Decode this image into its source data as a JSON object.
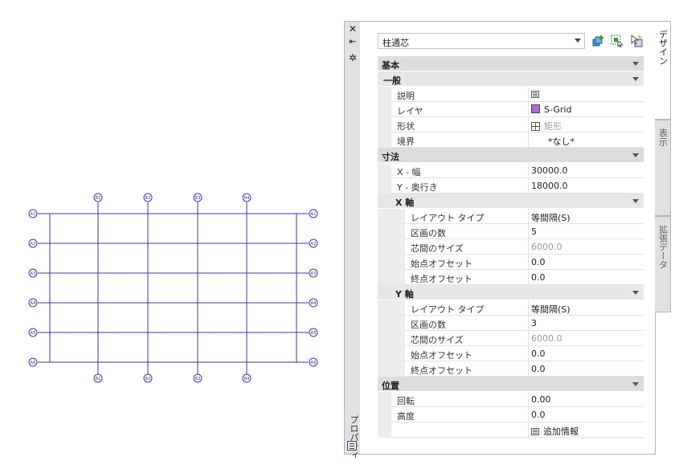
{
  "palette": {
    "title": "プロパティ",
    "style_name": "柱通芯",
    "tabs": [
      "デザイン",
      "表示",
      "拡張データ"
    ]
  },
  "drawing": {
    "bubbles_top": [
      "B1",
      "B2",
      "B3",
      "B4"
    ],
    "bubbles_bottom": [
      "B1",
      "B2",
      "B3",
      "B4"
    ],
    "bubbles_left": [
      "A1",
      "A2",
      "A3",
      "A4",
      "A5",
      "A6"
    ],
    "bubbles_right": [
      "A1",
      "A2",
      "A3",
      "A4",
      "A5",
      "A6"
    ],
    "line_color": "#3a3aa8"
  },
  "properties": {
    "kihon": {
      "label": "基本",
      "ippan": {
        "label": "一般",
        "setsumei": {
          "name": "説明",
          "value": ""
        },
        "layer": {
          "name": "レイヤ",
          "value": "S-Grid",
          "color": "#b06ad8"
        },
        "shape": {
          "name": "形状",
          "value": "矩形"
        },
        "boundary": {
          "name": "境界",
          "value": "*なし*"
        }
      }
    },
    "sunpou": {
      "label": "寸法",
      "x_width": {
        "name": "X - 幅",
        "value": "30000.0"
      },
      "y_depth": {
        "name": "Y - 奥行き",
        "value": "18000.0"
      },
      "x_axis": {
        "label": "X 軸",
        "layout_type": {
          "name": "レイアウト タイプ",
          "value": "等間隔(S)"
        },
        "bays": {
          "name": "区画の数",
          "value": "5"
        },
        "bay_size": {
          "name": "芯間のサイズ",
          "value": "6000.0"
        },
        "start_offset": {
          "name": "始点オフセット",
          "value": "0.0"
        },
        "end_offset": {
          "name": "終点オフセット",
          "value": "0.0"
        }
      },
      "y_axis": {
        "label": "Y 軸",
        "layout_type": {
          "name": "レイアウト タイプ",
          "value": "等間隔(S)"
        },
        "bays": {
          "name": "区画の数",
          "value": "3"
        },
        "bay_size": {
          "name": "芯間のサイズ",
          "value": "6000.0"
        },
        "start_offset": {
          "name": "始点オフセット",
          "value": "0.0"
        },
        "end_offset": {
          "name": "終点オフセット",
          "value": "0.0"
        }
      }
    },
    "ichi": {
      "label": "位置",
      "rotation": {
        "name": "回転",
        "value": "0.00"
      },
      "elevation": {
        "name": "高度",
        "value": "0.0"
      },
      "additional": {
        "value": "追加情報"
      }
    }
  }
}
